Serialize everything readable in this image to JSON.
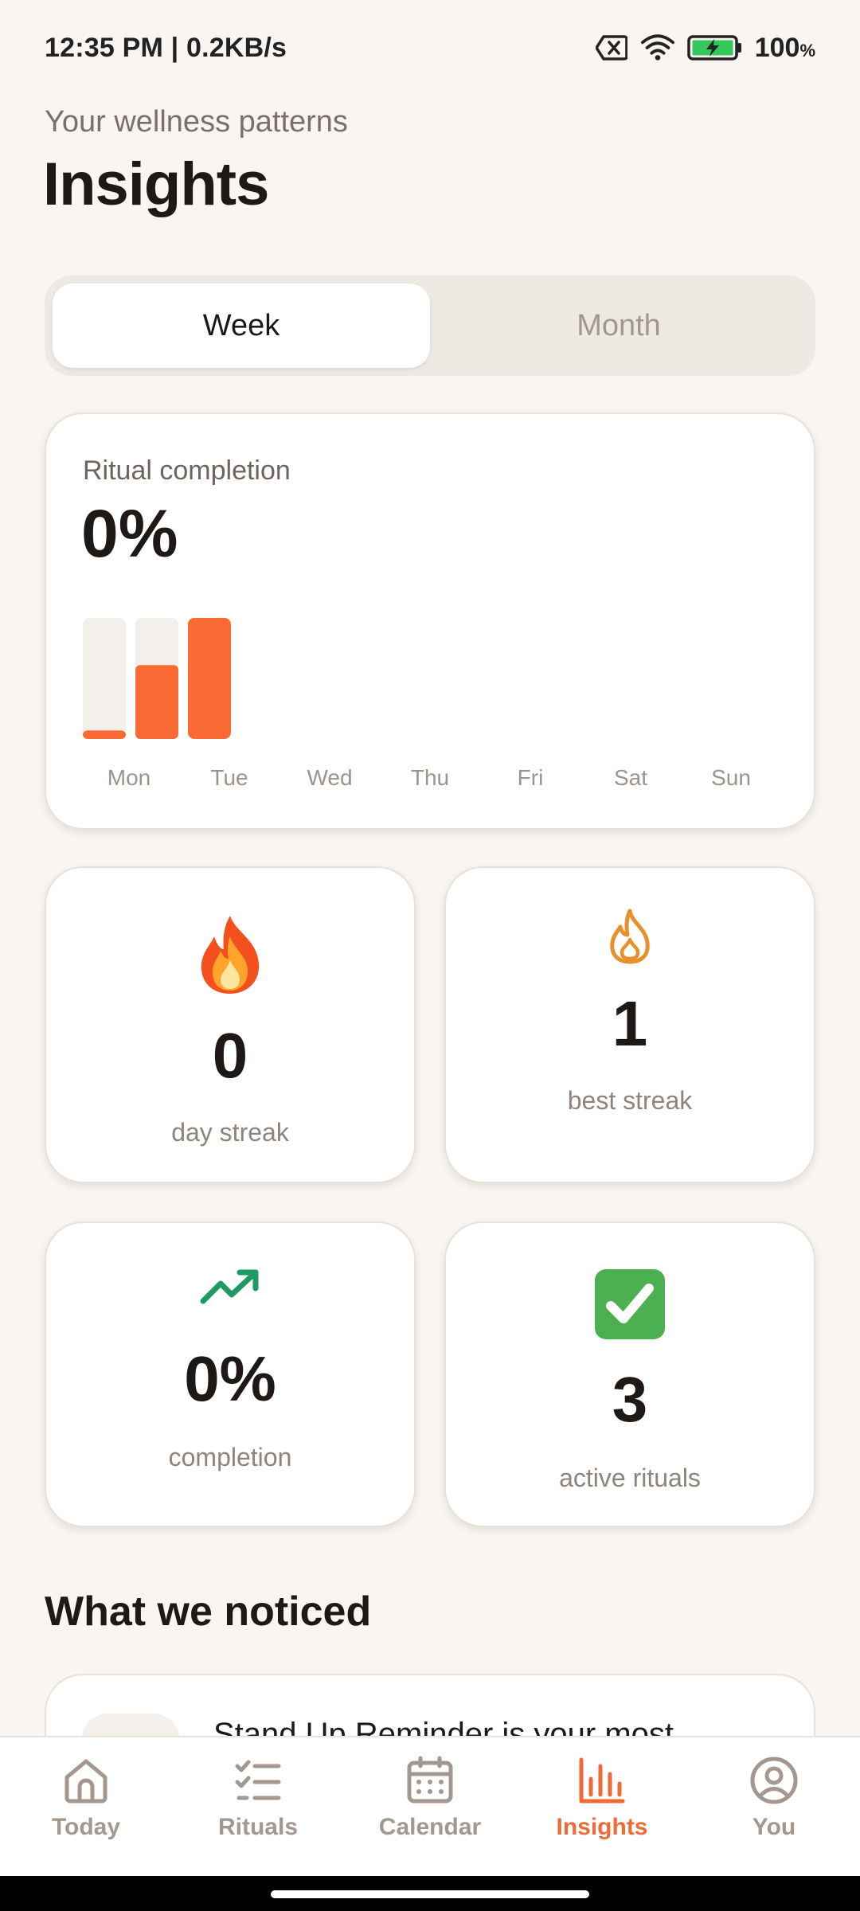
{
  "status_bar": {
    "time_speed": "12:35 PM | 0.2KB/s",
    "battery_value": "100",
    "battery_unit": "%"
  },
  "header": {
    "subtitle": "Your wellness patterns",
    "title": "Insights"
  },
  "range_toggle": {
    "options": [
      "Week",
      "Month"
    ],
    "selected": "Week"
  },
  "completion_card": {
    "label": "Ritual completion",
    "value": "0%"
  },
  "chart_data": {
    "type": "bar",
    "categories": [
      "Mon",
      "Tue",
      "Wed",
      "Thu",
      "Fri",
      "Sat",
      "Sun"
    ],
    "series": [
      {
        "values": [
          0.07,
          0.61,
          null,
          null,
          null,
          null,
          null
        ]
      },
      {
        "values": [
          null,
          null,
          1.0,
          null,
          null,
          null,
          null
        ]
      }
    ],
    "ylim": [
      0,
      1
    ],
    "colors": {
      "fill": "#fa6a35",
      "track": "#f3efeb",
      "label": "#9e938b"
    }
  },
  "stats": {
    "day_streak": {
      "value": "0",
      "label": "day streak",
      "icon": "fire-emoji-icon"
    },
    "best_streak": {
      "value": "1",
      "label": "best streak",
      "icon": "flame-outline-icon"
    },
    "completion": {
      "value": "0%",
      "label": "completion",
      "icon": "trending-up-icon"
    },
    "active_rituals": {
      "value": "3",
      "label": "active rituals",
      "icon": "check-box-icon"
    }
  },
  "noticed": {
    "title": "What we noticed",
    "first_item_text": "Stand Up Reminder is your most"
  },
  "bottom_nav": {
    "items": [
      {
        "label": "Today",
        "icon": "home-icon"
      },
      {
        "label": "Rituals",
        "icon": "checklist-icon"
      },
      {
        "label": "Calendar",
        "icon": "calendar-icon"
      },
      {
        "label": "Insights",
        "icon": "bar-chart-icon"
      },
      {
        "label": "You",
        "icon": "profile-icon"
      }
    ],
    "active": "Insights"
  },
  "colors": {
    "accent": "#f06a35",
    "background": "#f8f5f2",
    "muted_text": "#a39890",
    "trend_green": "#1f9a63",
    "best_streak_orange": "#e8912a"
  }
}
